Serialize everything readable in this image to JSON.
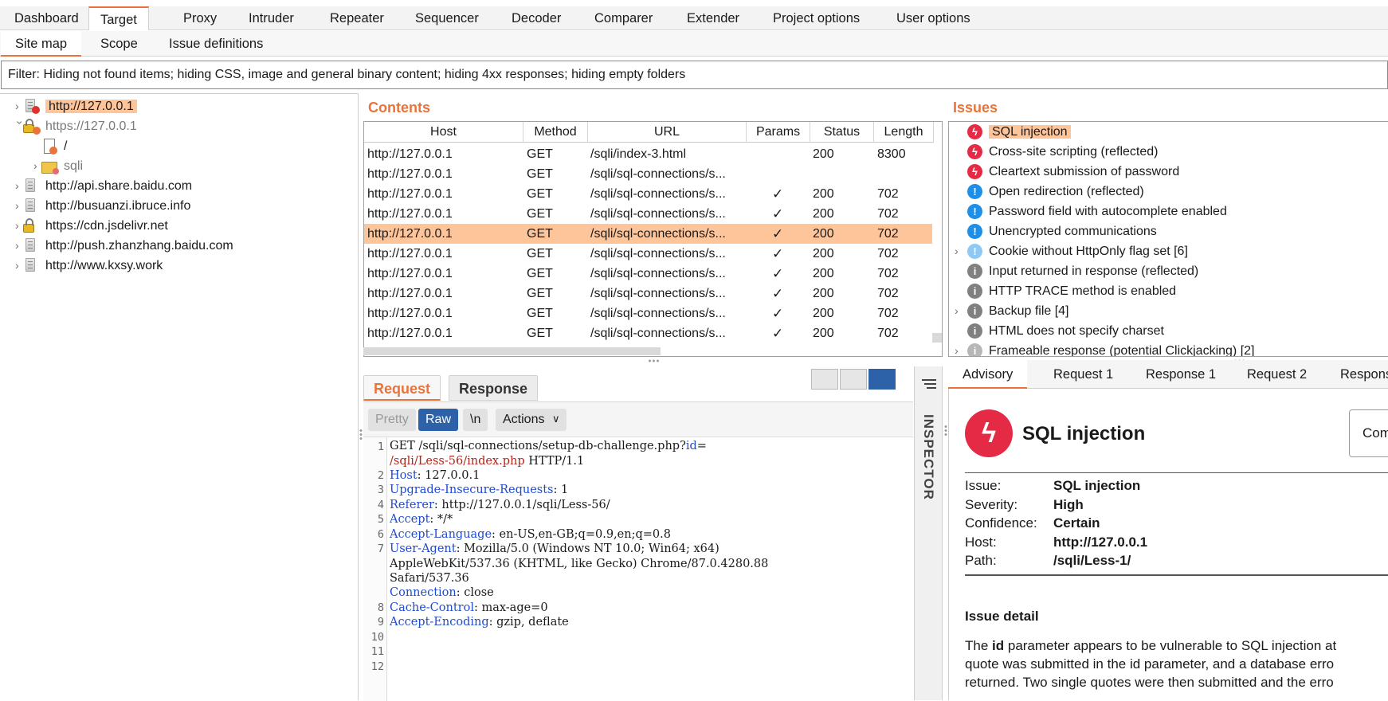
{
  "top_tabs": [
    "Dashboard",
    "Target",
    "Proxy",
    "Intruder",
    "Repeater",
    "Sequencer",
    "Decoder",
    "Comparer",
    "Extender",
    "Project options",
    "User options"
  ],
  "sub_tabs": [
    "Site map",
    "Scope",
    "Issue definitions"
  ],
  "filter_text": "Filter: Hiding not found items;  hiding CSS, image and general binary content;  hiding 4xx responses;  hiding empty folders",
  "site_tree": [
    "http://127.0.0.1",
    "https://127.0.0.1",
    "/",
    "sqli",
    "http://api.share.baidu.com",
    "http://busuanzi.ibruce.info",
    "https://cdn.jsdelivr.net",
    "http://push.zhanzhang.baidu.com",
    "http://www.kxsy.work"
  ],
  "contents": {
    "title": "Contents",
    "columns": [
      "Host",
      "Method",
      "URL",
      "Params",
      "Status",
      "Length"
    ],
    "rows": [
      {
        "host": "http://127.0.0.1",
        "method": "GET",
        "url": "/sqli/index-3.html",
        "params": "",
        "status": "200",
        "length": "8300"
      },
      {
        "host": "http://127.0.0.1",
        "method": "GET",
        "url": "/sqli/sql-connections/s...",
        "params": "",
        "status": "",
        "length": ""
      },
      {
        "host": "http://127.0.0.1",
        "method": "GET",
        "url": "/sqli/sql-connections/s...",
        "params": "✓",
        "status": "200",
        "length": "702"
      },
      {
        "host": "http://127.0.0.1",
        "method": "GET",
        "url": "/sqli/sql-connections/s...",
        "params": "✓",
        "status": "200",
        "length": "702"
      },
      {
        "host": "http://127.0.0.1",
        "method": "GET",
        "url": "/sqli/sql-connections/s...",
        "params": "✓",
        "status": "200",
        "length": "702"
      },
      {
        "host": "http://127.0.0.1",
        "method": "GET",
        "url": "/sqli/sql-connections/s...",
        "params": "✓",
        "status": "200",
        "length": "702"
      },
      {
        "host": "http://127.0.0.1",
        "method": "GET",
        "url": "/sqli/sql-connections/s...",
        "params": "✓",
        "status": "200",
        "length": "702"
      },
      {
        "host": "http://127.0.0.1",
        "method": "GET",
        "url": "/sqli/sql-connections/s...",
        "params": "✓",
        "status": "200",
        "length": "702"
      },
      {
        "host": "http://127.0.0.1",
        "method": "GET",
        "url": "/sqli/sql-connections/s...",
        "params": "✓",
        "status": "200",
        "length": "702"
      },
      {
        "host": "http://127.0.0.1",
        "method": "GET",
        "url": "/sqli/sql-connections/s...",
        "params": "✓",
        "status": "200",
        "length": "702"
      }
    ]
  },
  "issues": {
    "title": "Issues",
    "items": [
      {
        "label": "SQL injection",
        "severity": "high",
        "icon": "lightning-icon"
      },
      {
        "label": "Cross-site scripting (reflected)",
        "severity": "high",
        "icon": "lightning-icon"
      },
      {
        "label": "Cleartext submission of password",
        "severity": "high",
        "icon": "lightning-icon"
      },
      {
        "label": "Open redirection (reflected)",
        "severity": "info",
        "icon": "exclamation-icon"
      },
      {
        "label": "Password field with autocomplete enabled",
        "severity": "info",
        "icon": "exclamation-icon"
      },
      {
        "label": "Unencrypted communications",
        "severity": "info",
        "icon": "exclamation-icon"
      },
      {
        "label": "Cookie without HttpOnly flag set [6]",
        "severity": "info-light",
        "icon": "exclamation-icon"
      },
      {
        "label": "Input returned in response (reflected)",
        "severity": "low",
        "icon": "info-icon"
      },
      {
        "label": "HTTP TRACE method is enabled",
        "severity": "low",
        "icon": "info-icon"
      },
      {
        "label": "Backup file [4]",
        "severity": "low",
        "icon": "info-icon"
      },
      {
        "label": "HTML does not specify charset",
        "severity": "low",
        "icon": "info-icon"
      },
      {
        "label": "Frameable response (potential Clickjacking) [2]",
        "severity": "low-light",
        "icon": "info-icon"
      }
    ]
  },
  "request": {
    "tabs": [
      "Request",
      "Response"
    ],
    "toolbar": {
      "pretty": "Pretty",
      "raw": "Raw",
      "newline": "\\n",
      "actions": "Actions"
    },
    "line_numbers": [
      "1",
      "2",
      "3",
      "4",
      "5",
      "6",
      "7",
      "8",
      "9",
      "10",
      "11",
      "12"
    ],
    "lines": [
      {
        "pre": "GET /sqli/sql-connections/setup-db-challenge.php?",
        "key": "id",
        "post": "="
      },
      {
        "red": "/sqli/Less-56/index.php",
        "post": " HTTP/1.1"
      },
      {
        "key": "Host",
        "post": ": 127.0.0.1"
      },
      {
        "key": "Upgrade-Insecure-Requests",
        "post": ": 1"
      },
      {
        "key": "Referer",
        "post": ": http://127.0.0.1/sqli/Less-56/"
      },
      {
        "key": "Accept",
        "post": ": */*"
      },
      {
        "key": "Accept-Language",
        "post": ": en-US,en-GB;q=0.9,en;q=0.8"
      },
      {
        "key": "User-Agent",
        "post": ": Mozilla/5.0 (Windows NT 10.0; Win64; x64)"
      },
      {
        "post": "AppleWebKit/537.36 (KHTML, like Gecko) Chrome/87.0.4280.88"
      },
      {
        "post": "Safari/537.36"
      },
      {
        "key": "Connection",
        "post": ": close"
      },
      {
        "key": "Cache-Control",
        "post": ": max-age=0"
      },
      {
        "key": "Accept-Encoding",
        "post": ": gzip, deflate"
      }
    ]
  },
  "inspector_label": "INSPECTOR",
  "advisory": {
    "tabs": [
      "Advisory",
      "Request 1",
      "Response 1",
      "Request 2",
      "Response"
    ],
    "title": "SQL injection",
    "side_button": "Com",
    "fields": [
      {
        "k": "Issue:",
        "v": "SQL injection"
      },
      {
        "k": "Severity:",
        "v": "High"
      },
      {
        "k": "Confidence:",
        "v": "Certain"
      },
      {
        "k": "Host:",
        "v": "http://127.0.0.1"
      },
      {
        "k": "Path:",
        "v": "/sqli/Less-1/"
      }
    ],
    "detail_heading": "Issue detail",
    "detail_lines": [
      {
        "pre": "The ",
        "bold": "id",
        "post": " parameter appears to be vulnerable to SQL injection at"
      },
      {
        "pre": "quote was submitted in the id parameter, and a database erro"
      },
      {
        "pre": "returned. Two single quotes were then submitted and the erro"
      }
    ]
  },
  "colors": {
    "accent": "#e8743b",
    "highlight": "#ffc59a",
    "high": "#e42a45",
    "info": "#1e8fe8",
    "low": "#808080",
    "raw_button": "#2d62a8"
  }
}
